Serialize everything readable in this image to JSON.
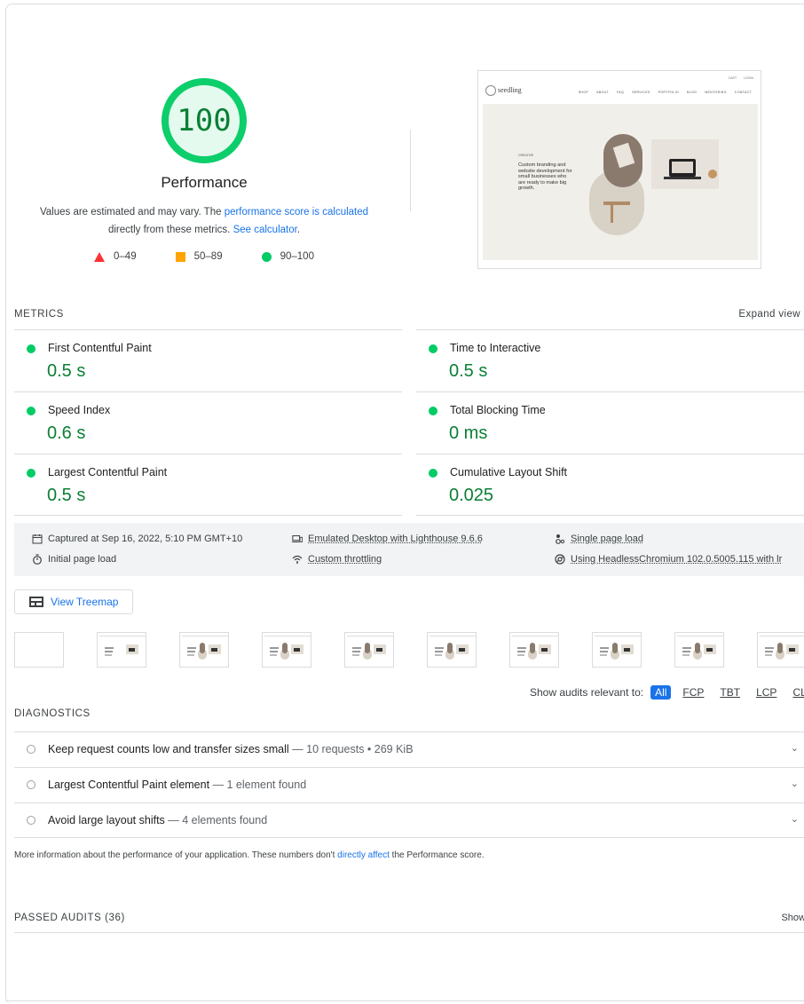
{
  "score": {
    "value": "100",
    "fraction": 1.0,
    "label": "Performance",
    "color": "#0cce6b"
  },
  "note": {
    "before": "Values are estimated and may vary. The ",
    "link1": "performance score is calculated",
    "middle": " directly from these metrics. ",
    "link2": "See calculator",
    "after": "."
  },
  "legend": [
    {
      "range": "0–49",
      "shape": "triangle",
      "color": "#ff3333"
    },
    {
      "range": "50–89",
      "shape": "square",
      "color": "#ffa400"
    },
    {
      "range": "90–100",
      "shape": "circle",
      "color": "#0cce6b"
    }
  ],
  "final_screenshot": {
    "topbar": [
      "CART",
      "LOGIN"
    ],
    "logo": "seedling",
    "nav": [
      "SHOP",
      "ABOUT",
      "FAQ",
      "SERVICES",
      "PORTFOLIO",
      "BLOG",
      "MENTORING",
      "CONTACT"
    ],
    "kicker": "CREATIVE",
    "headline": "Custom branding and website development for small businesses who are ready to make big growth."
  },
  "metrics": {
    "title": "METRICS",
    "expand": "Expand view",
    "items": [
      {
        "name": "First Contentful Paint",
        "value": "0.5 s"
      },
      {
        "name": "Time to Interactive",
        "value": "0.5 s"
      },
      {
        "name": "Speed Index",
        "value": "0.6 s"
      },
      {
        "name": "Total Blocking Time",
        "value": "0 ms"
      },
      {
        "name": "Largest Contentful Paint",
        "value": "0.5 s"
      },
      {
        "name": "Cumulative Layout Shift",
        "value": "0.025"
      }
    ]
  },
  "runtime": {
    "captured": "Captured at Sep 16, 2022, 5:10 PM GMT+10",
    "initial": "Initial page load",
    "emulated": "Emulated Desktop with Lighthouse 9.6.6",
    "throttling": "Custom throttling",
    "single": "Single page load",
    "browser": "Using HeadlessChromium 102.0.5005.115 with lr"
  },
  "treemap": {
    "label": "View Treemap"
  },
  "filter": {
    "label": "Show audits relevant to:",
    "options": [
      "All",
      "FCP",
      "TBT",
      "LCP",
      "CLS"
    ]
  },
  "diagnostics": {
    "title": "DIAGNOSTICS",
    "items": [
      {
        "title": "Keep request counts low and transfer sizes small",
        "detail": " — 10 requests • 269 KiB"
      },
      {
        "title": "Largest Contentful Paint element",
        "detail": " — 1 element found"
      },
      {
        "title": "Avoid large layout shifts",
        "detail": " — 4 elements found"
      }
    ],
    "note_before": "More information about the performance of your application. These numbers don't ",
    "note_link": "directly affect",
    "note_after": " the Performance score."
  },
  "passed": {
    "title": "PASSED AUDITS (36)",
    "show": "Show"
  }
}
